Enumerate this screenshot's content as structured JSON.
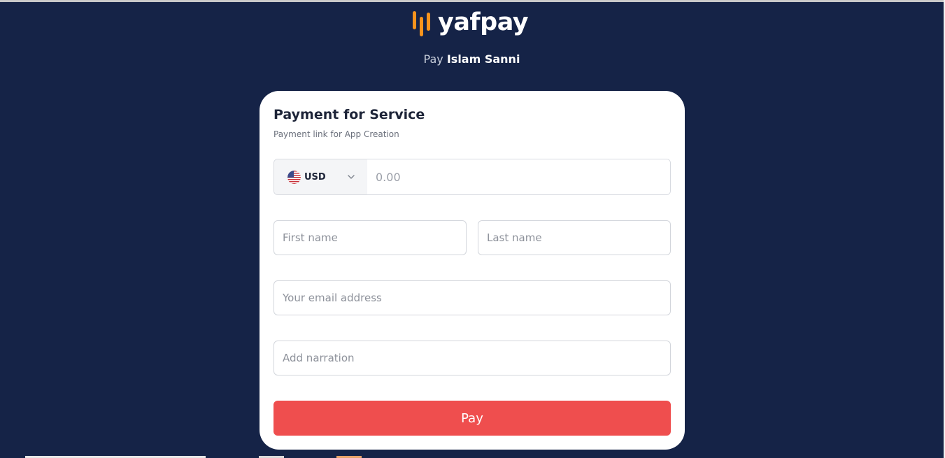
{
  "brand": {
    "name": "yafpay",
    "accent": "#f7941d",
    "background": "#152347"
  },
  "header": {
    "pay_prefix": "Pay",
    "merchant_name": "Islam Sanni"
  },
  "card": {
    "title": "Payment for Service",
    "subtitle": "Payment link for App Creation"
  },
  "amount": {
    "currency_flag_icon": "us-flag-icon",
    "currency": "USD",
    "placeholder": "0.00"
  },
  "form": {
    "first_name_placeholder": "First name",
    "last_name_placeholder": "Last name",
    "email_placeholder": "Your email address",
    "narration_placeholder": "Add narration"
  },
  "actions": {
    "pay_label": "Pay",
    "pay_color": "#ef4e4e"
  }
}
